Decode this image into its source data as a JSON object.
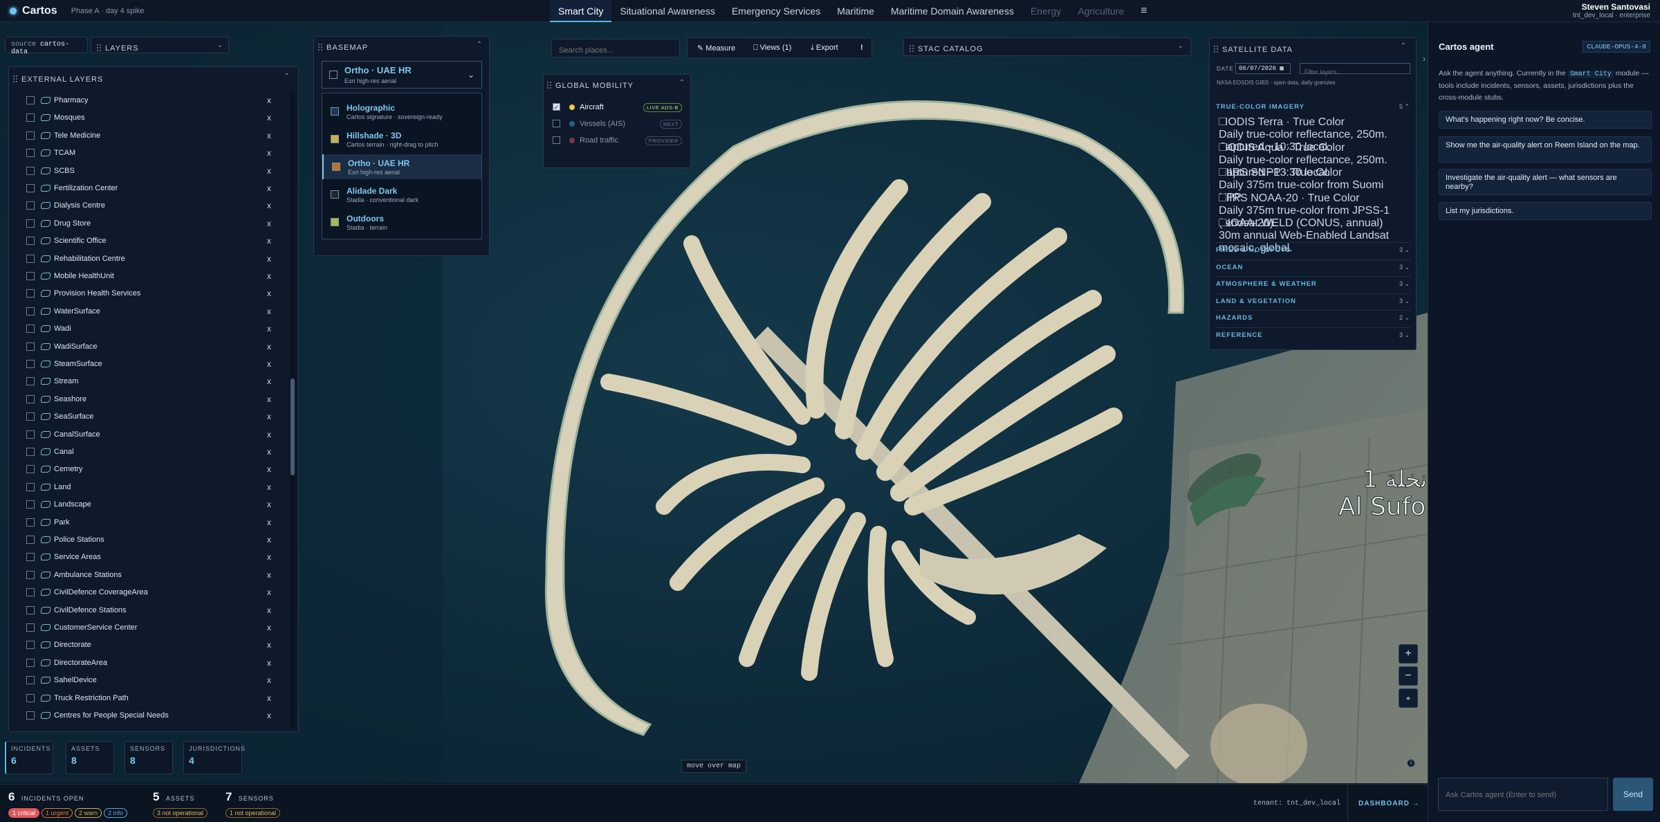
{
  "app": {
    "name": "Cartos",
    "phase": "Phase A · day 4 spike"
  },
  "nav": {
    "tabs": [
      {
        "label": "Smart City",
        "active": true
      },
      {
        "label": "Situational Awareness"
      },
      {
        "label": "Emergency Services"
      },
      {
        "label": "Maritime"
      },
      {
        "label": "Maritime Domain Awareness"
      },
      {
        "label": "Energy",
        "disabled": true
      },
      {
        "label": "Agriculture",
        "disabled": true
      }
    ],
    "menu_icon": "hamburger-icon"
  },
  "user": {
    "name": "Steven Santovasi",
    "tenant": "tnt_dev_local · enterprise"
  },
  "source": {
    "prefix": "source",
    "value": "cartos-data"
  },
  "layers_dropdown": "LAYERS",
  "external_layers": {
    "title": "EXTERNAL LAYERS",
    "items": [
      "Pharmacy",
      "Mosques",
      "Tele Medicine",
      "TCAM",
      "SCBS",
      "Fertilization Center",
      "Dialysis Centre",
      "Drug Store",
      "Scientific Office",
      "Rehabilitation Centre",
      "Mobile HealthUnit",
      "Provision Health Services",
      "WaterSurface",
      "Wadi",
      "WadiSurface",
      "SteamSurface",
      "Stream",
      "Seashore",
      "SeaSurface",
      "CanalSurface",
      "Canal",
      "Cemetry",
      "Land",
      "Landscape",
      "Park",
      "Police Stations",
      "Service Areas",
      "Ambulance Stations",
      "CivilDefence CoverageArea",
      "CivilDefence Stations",
      "CustomerService Center",
      "Directorate",
      "DirectorateArea",
      "SahelDevice",
      "Truck Restriction Path",
      "Centres for People Special Needs"
    ],
    "remove": "x"
  },
  "basemap": {
    "title": "BASEMAP",
    "selected": {
      "name": "Ortho · UAE HR",
      "sub": "Esri high-res aerial"
    },
    "options": [
      {
        "name": "Holographic",
        "sub": "Cartos signature · sovereign-ready",
        "swatch": "#1a3a5a"
      },
      {
        "name": "Hillshade · 3D",
        "sub": "Cartos terrain · right-drag to pitch",
        "swatch": "#c9b04a"
      },
      {
        "name": "Ortho · UAE HR",
        "sub": "Esri high-res aerial",
        "swatch": "#b8722c",
        "active": true
      },
      {
        "name": "Alidade Dark",
        "sub": "Stadia · conventional dark",
        "swatch": "#20262e"
      },
      {
        "name": "Outdoors",
        "sub": "Stadia · terrain",
        "swatch": "#a8b84a"
      }
    ]
  },
  "global_mobility": {
    "title": "GLOBAL MOBILITY",
    "items": [
      {
        "label": "Aircraft",
        "tag": "LIVE ADS-B",
        "checked": true,
        "dot": "#f2c94c"
      },
      {
        "label": "Vessels (AIS)",
        "tag": "NEXT",
        "checked": false,
        "dot": "#3f9fd3"
      },
      {
        "label": "Road traffic",
        "tag": "PROVIDER",
        "checked": false,
        "dot": "#d9534f"
      }
    ]
  },
  "search": {
    "placeholder": "Search places..."
  },
  "toolbar": {
    "measure": "Measure",
    "views": "Views (1)",
    "export": "Export",
    "alert": "!"
  },
  "stac": {
    "title": "STAC CATALOG"
  },
  "satellite": {
    "title": "SATELLITE DATA",
    "date_label": "DATE",
    "date": "06/07/2026",
    "filter_placeholder": "Filter layers...",
    "source_note": "NASA EOSDIS GIBS · open data, daily granules",
    "true_color": {
      "name": "TRUE-COLOR IMAGERY",
      "count": "5",
      "items": [
        {
          "title": "MODIS Terra · True Color",
          "sub": "Daily true-color reflectance, 250m. Captured ~10:30 local."
        },
        {
          "title": "MODIS Aqua · True Color",
          "sub": "Daily true-color reflectance, 250m. Captured ~13:30 local."
        },
        {
          "title": "VIIRS SNPP · True Color",
          "sub": "Daily 375m true-color from Suomi NPP."
        },
        {
          "title": "VIIRS NOAA-20 · True Color",
          "sub": "Daily 375m true-color from JPSS-1 (NOAA-20)."
        },
        {
          "title": "Landsat WELD (CONUS, annual)",
          "sub": "30m annual Web-Enabled Landsat mosaic, global."
        }
      ]
    },
    "categories": [
      {
        "name": "FIRES & HOTSPOTS",
        "count": "3"
      },
      {
        "name": "OCEAN",
        "count": "3"
      },
      {
        "name": "ATMOSPHERE & WEATHER",
        "count": "3"
      },
      {
        "name": "LAND & VEGETATION",
        "count": "3"
      },
      {
        "name": "HAZARDS",
        "count": "2"
      },
      {
        "name": "REFERENCE",
        "count": "3"
      }
    ]
  },
  "map_labels": {
    "arabic": "نخلة 1",
    "latin": "Al Sufo"
  },
  "coords": "move over map",
  "stats": [
    {
      "label": "INCIDENTS",
      "value": "6"
    },
    {
      "label": "ASSETS",
      "value": "8"
    },
    {
      "label": "SENSORS",
      "value": "8"
    },
    {
      "label": "JURISDICTIONS",
      "value": "4"
    }
  ],
  "footer": {
    "incidents_count": "6",
    "incidents_label": "INCIDENTS OPEN",
    "pills": [
      {
        "text": "1 critical",
        "color": "#e0555c"
      },
      {
        "text": "1 urgent",
        "color": "#e07a3a"
      },
      {
        "text": "2 warn",
        "color": "#d6b04a"
      },
      {
        "text": "2 info",
        "color": "#5aa6d6"
      }
    ],
    "assets_count": "5",
    "assets_label": "ASSETS",
    "assets_pill": "3 not operational",
    "sensors_count": "7",
    "sensors_label": "SENSORS",
    "sensors_pill": "1 not operational",
    "tenant": "tenant: tnt_dev_local",
    "dashboard": "DASHBOARD →"
  },
  "agent": {
    "title": "Cartos agent",
    "model": "CLAUDE-OPUS-4-8",
    "intro_1": "Ask the agent anything. Currently in the",
    "module": "Smart City",
    "intro_2": "module — tools include incidents, sensors, assets, jurisdictions plus the cross-module stubs.",
    "examples": [
      "What's happening right now? Be concise.",
      "Show me the air-quality alert on Reem Island on the map.",
      "Investigate the air-quality alert — what sensors are nearby?",
      "List my jurisdictions."
    ],
    "input_placeholder": "Ask Cartos agent (Enter to send)",
    "send": "Send"
  },
  "colors": {
    "accent": "#5fb6e6",
    "panel": "#0e1a2b",
    "bg": "#0b1421"
  }
}
